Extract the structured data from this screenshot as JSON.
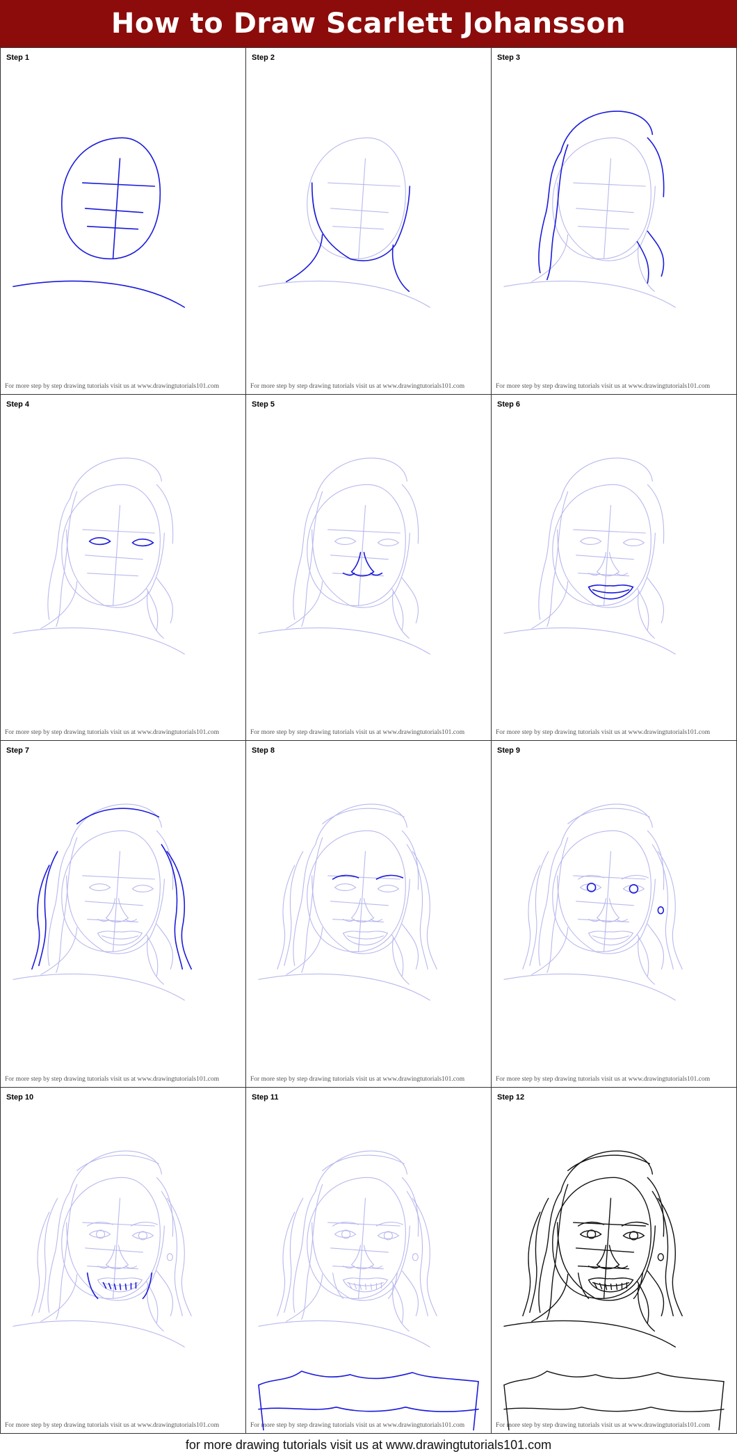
{
  "header": {
    "title": "How to Draw Scarlett Johansson"
  },
  "steps": [
    {
      "label": "Step 1",
      "footer": "For more step by step drawing tutorials visit us at www.drawingtutorials101.com"
    },
    {
      "label": "Step 2",
      "footer": "For more step by step drawing tutorials visit us at www.drawingtutorials101.com"
    },
    {
      "label": "Step 3",
      "footer": "For more step by step drawing tutorials visit us at www.drawingtutorials101.com"
    },
    {
      "label": "Step 4",
      "footer": "For more step by step drawing tutorials visit us at www.drawingtutorials101.com"
    },
    {
      "label": "Step 5",
      "footer": "For more step by step drawing tutorials visit us at www.drawingtutorials101.com"
    },
    {
      "label": "Step 6",
      "footer": "For more step by step drawing tutorials visit us at www.drawingtutorials101.com"
    },
    {
      "label": "Step 7",
      "footer": "For more step by step drawing tutorials visit us at www.drawingtutorials101.com"
    },
    {
      "label": "Step 8",
      "footer": "For more step by step drawing tutorials visit us at www.drawingtutorials101.com"
    },
    {
      "label": "Step 9",
      "footer": "For more step by step drawing tutorials visit us at www.drawingtutorials101.com"
    },
    {
      "label": "Step 10",
      "footer": "For more step by step drawing tutorials visit us at www.drawingtutorials101.com"
    },
    {
      "label": "Step 11",
      "footer": "For more step by step drawing tutorials visit us at www.drawingtutorials101.com"
    },
    {
      "label": "Step 12",
      "footer": "For more step by step drawing tutorials visit us at www.drawingtutorials101.com"
    }
  ],
  "footer": {
    "text": "for more drawing tutorials visit us at www.drawingtutorials101.com"
  },
  "colors": {
    "header_bg": "#8c0c0c",
    "new_stroke": "#1a1adb",
    "guide_stroke": "#b8b8ee",
    "final_stroke": "#111111"
  }
}
